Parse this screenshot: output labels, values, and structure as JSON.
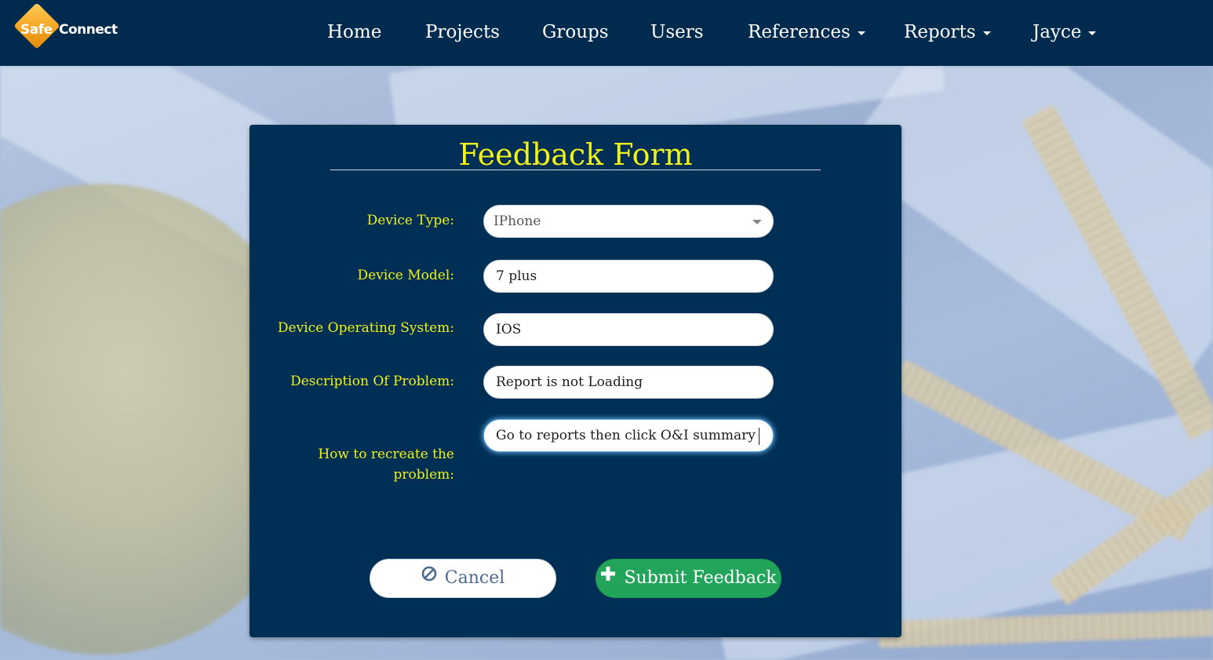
{
  "brand": {
    "logo_safe": "Safe",
    "logo_connect": "Connect"
  },
  "nav": {
    "items": [
      {
        "label": "Home",
        "dropdown": false
      },
      {
        "label": "Projects",
        "dropdown": false
      },
      {
        "label": "Groups",
        "dropdown": false
      },
      {
        "label": "Users",
        "dropdown": false
      },
      {
        "label": "References",
        "dropdown": true
      },
      {
        "label": "Reports",
        "dropdown": true
      },
      {
        "label": "Jayce",
        "dropdown": true
      }
    ]
  },
  "form": {
    "title": "Feedback Form",
    "fields": {
      "device_type": {
        "label": "Device Type:",
        "value": "IPhone"
      },
      "device_model": {
        "label": "Device Model:",
        "value": "7 plus"
      },
      "device_os": {
        "label": "Device Operating System:",
        "value": "IOS"
      },
      "description": {
        "label": "Description Of Problem:",
        "value": "Report is not Loading"
      },
      "recreate": {
        "label_line1": "How to recreate the",
        "label_line2": "problem:",
        "value": "Go to reports then click O&I summary"
      }
    },
    "buttons": {
      "cancel_label": "Cancel",
      "submit_label": "Submit Feedback"
    }
  },
  "colors": {
    "navbar": "#002b4e",
    "panel": "#002f55",
    "label": "#f2f21a",
    "submit": "#22a55a",
    "cancel_text": "#4d6a92",
    "logo_orange": "#f4a21c"
  },
  "icons": {
    "cancel": "ban-icon",
    "submit": "plus-icon",
    "dropdown": "caret-down-icon"
  }
}
